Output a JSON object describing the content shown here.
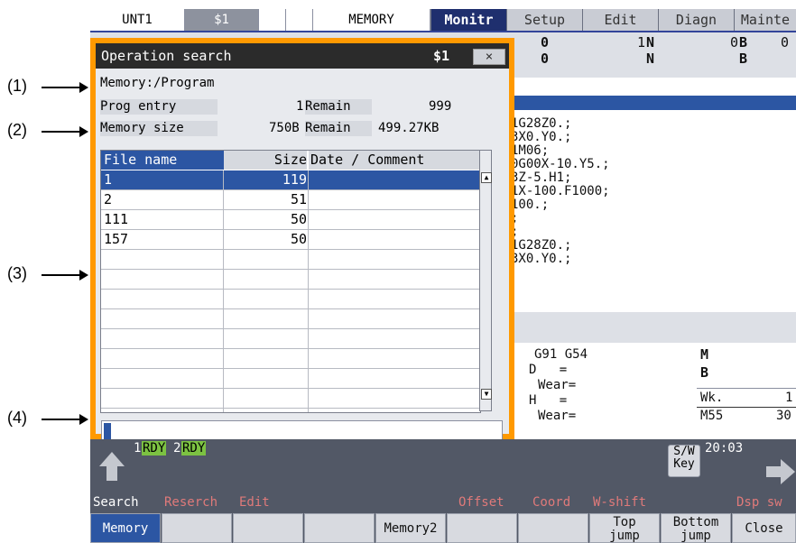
{
  "callouts": [
    "(1)",
    "(2)",
    "(3)",
    "(4)"
  ],
  "topbar": {
    "unit": "UNT1",
    "system": "$1",
    "mode": "MEMORY",
    "tabs": [
      "Monitr",
      "Setup",
      "Edit",
      "Diagn",
      "Mainte"
    ],
    "active_tab": "Monitr"
  },
  "background": {
    "counters_row1": [
      "0",
      "1",
      "N",
      "0",
      "B",
      "0"
    ],
    "counters_row2": [
      "0",
      "N",
      "B"
    ],
    "program_lines": [
      "1G28Z0.;",
      "3X0.Y0.;",
      "1M06;",
      "0G00X-10.Y5.;",
      "3Z-5.H1;",
      "1X-100.F1000;",
      "100.;",
      ";",
      ";",
      "1G28Z0.;",
      "3X0.Y0.;"
    ],
    "modal": "G91 G54",
    "offset_d": "D   =",
    "wear1": "Wear=",
    "offset_h": "H   =",
    "wear2": "Wear=",
    "side_m": "M",
    "side_b": "B",
    "wk_label": "Wk.",
    "m55": "M55",
    "wk_val": "1",
    "m55_val": "30"
  },
  "dialog": {
    "title": "Operation search",
    "system": "$1",
    "close_symbol": "×",
    "path": "Memory:/Program",
    "prog_entry_label": "Prog entry",
    "prog_entry_value": "1",
    "remain_label": "Remain",
    "prog_remain_value": "999",
    "memory_size_label": "Memory size",
    "memory_size_value": "750B",
    "memory_remain_value": "499.27KB",
    "table_headers": [
      "File name",
      "Size",
      "Date / Comment"
    ],
    "files": [
      {
        "name": "1",
        "size": "119",
        "comment": ""
      },
      {
        "name": "2",
        "size": "51",
        "comment": ""
      },
      {
        "name": "111",
        "size": "50",
        "comment": ""
      },
      {
        "name": "157",
        "size": "50",
        "comment": ""
      }
    ],
    "input_value": ""
  },
  "status": {
    "rdy1_num": "1",
    "rdy1": "RDY",
    "rdy2_num": "2",
    "rdy2": "RDY",
    "sw_key": "S/W\nKey",
    "time": "20:03"
  },
  "key_labels": [
    "Search",
    "Reserch",
    "Edit",
    "Offset",
    "Coord",
    "W-shift",
    "Dsp sw"
  ],
  "softkeys": [
    "Memory",
    "",
    "",
    "",
    "Memory2",
    "",
    "",
    "Top\njump",
    "Bottom\njump",
    "Close"
  ],
  "colors": {
    "highlight": "#ff9900",
    "selection": "#2c56a3",
    "active_tab_bg": "#1f2f6e",
    "ready_green": "#7cc242"
  }
}
